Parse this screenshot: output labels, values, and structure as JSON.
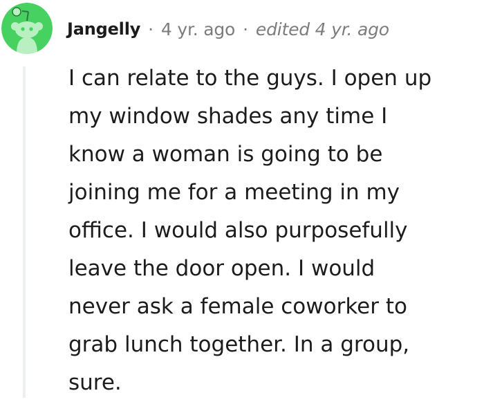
{
  "comment": {
    "author": "Jangelly",
    "separator": "·",
    "age": "4 yr. ago",
    "edited": "edited 4 yr. ago",
    "avatar_icon": "snoo-avatar-icon",
    "colors": {
      "avatar_bg": "#46d160",
      "text": "#1c1c1c",
      "meta": "#7c7c7c",
      "thread_line": "#edeff1"
    },
    "body_lines": [
      "I can relate to the guys. I open up",
      "my window shades any time I",
      "know a woman is going to be",
      "joining me for a meeting in my",
      "office. I would also purposefully",
      "leave the door open. I would",
      "never ask a female coworker to",
      "grab lunch together. In a group,",
      "sure."
    ]
  }
}
